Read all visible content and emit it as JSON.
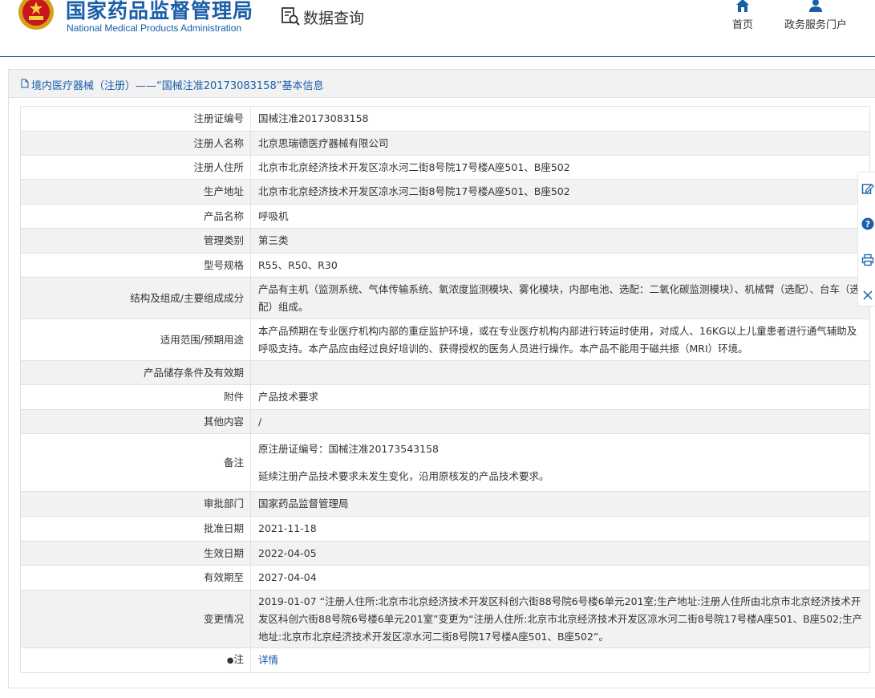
{
  "header": {
    "title_cn": "国家药品监督管理局",
    "title_en": "National Medical Products Administration",
    "section_label": "数据查询",
    "nav": [
      {
        "label": "首页",
        "icon": "home-icon"
      },
      {
        "label": "政务服务门户",
        "icon": "user-icon"
      }
    ]
  },
  "panel": {
    "title": "境内医疗器械（注册）——“国械注准20173083158”基本信息"
  },
  "fields": {
    "reg_no": {
      "label": "注册证编号",
      "value": "国械注准20173083158"
    },
    "registrant": {
      "label": "注册人名称",
      "value": "北京思瑞德医疗器械有限公司"
    },
    "registrant_addr": {
      "label": "注册人住所",
      "value": "北京市北京经济技术开发区凉水河二街8号院17号楼A座501、B座502"
    },
    "prod_addr": {
      "label": "生产地址",
      "value": "北京市北京经济技术开发区凉水河二街8号院17号楼A座501、B座502"
    },
    "product_name": {
      "label": "产品名称",
      "value": "呼吸机"
    },
    "mgmt_class": {
      "label": "管理类别",
      "value": "第三类"
    },
    "model": {
      "label": "型号规格",
      "value": "R55、R50、R30"
    },
    "structure": {
      "label": "结构及组成/主要组成成分",
      "value": "产品有主机（监测系统、气体传输系统、氧浓度监测模块、雾化模块，内部电池、选配：二氧化碳监测模块）、机械臂（选配）、台车（选配）组成。"
    },
    "scope": {
      "label": "适用范围/预期用途",
      "value": "本产品预期在专业医疗机构内部的重症监护环境，或在专业医疗机构内部进行转运时使用，对成人、16KG以上儿童患者进行通气辅助及呼吸支持。本产品应由经过良好培训的、获得授权的医务人员进行操作。本产品不能用于磁共振（MRI）环境。"
    },
    "storage": {
      "label": "产品储存条件及有效期",
      "value": ""
    },
    "attachment": {
      "label": "附件",
      "value": "产品技术要求"
    },
    "other": {
      "label": "其他内容",
      "value": "/"
    },
    "remark": {
      "label": "备注",
      "line1": "原注册证编号：国械注准20173543158",
      "line2": "延续注册产品技术要求未发生变化，沿用原核发的产品技术要求。"
    },
    "dept": {
      "label": "审批部门",
      "value": "国家药品监督管理局"
    },
    "approve_date": {
      "label": "批准日期",
      "value": "2021-11-18"
    },
    "effective_date": {
      "label": "生效日期",
      "value": "2022-04-05"
    },
    "expire": {
      "label": "有效期至",
      "value": "2027-04-04"
    },
    "changes": {
      "label": "变更情况",
      "value": "2019-01-07 “注册人住所:北京市北京经济技术开发区科创六街88号院6号楼6单元201室;生产地址:注册人住所由北京市北京经济技术开发区科创六街88号院6号楼6单元201室”变更为“注册人住所:北京市北京经济技术开发区凉水河二街8号院17号楼A座501、B座502;生产地址:北京市北京经济技术开发区凉水河二街8号院17号楼A座501、B座502”。"
    },
    "note": {
      "label": "注",
      "link": "详情"
    }
  },
  "colors": {
    "brand": "#1a5ea8",
    "row_alt": "#f2f2f2",
    "border": "#e1e1e1"
  }
}
